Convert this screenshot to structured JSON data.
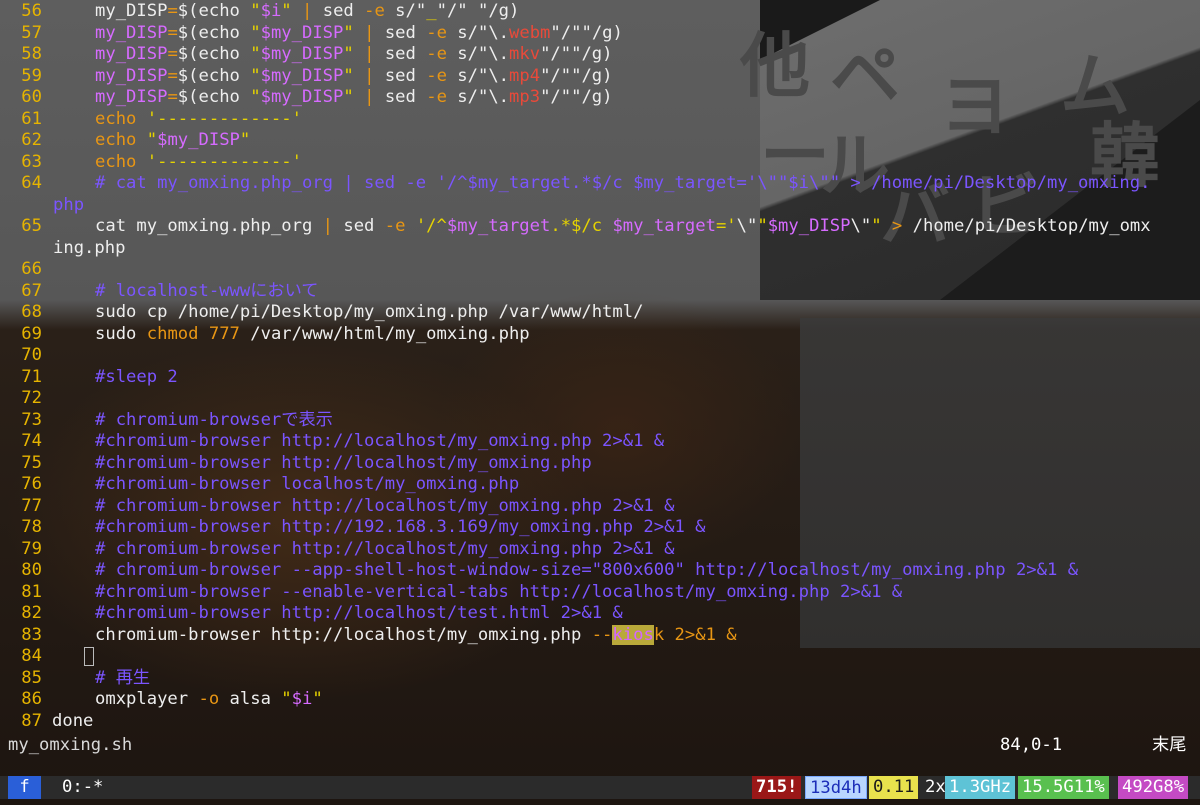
{
  "code_lines": [
    {
      "num": "56",
      "tokens": [
        [
          "def",
          "my_DISP"
        ],
        [
          "op",
          "="
        ],
        [
          "def",
          "$(echo "
        ],
        [
          "str",
          "\""
        ],
        [
          "var",
          "$i"
        ],
        [
          "str",
          "\""
        ],
        [
          "def",
          " "
        ],
        [
          "op",
          "|"
        ],
        [
          "def",
          " sed "
        ],
        [
          "op",
          "-e"
        ],
        [
          "def",
          " s/\""
        ],
        [
          "str",
          "_"
        ],
        [
          "def",
          "\"/\" \"/g)"
        ]
      ]
    },
    {
      "num": "57",
      "tokens": [
        [
          "var",
          "my_DISP"
        ],
        [
          "op",
          "="
        ],
        [
          "def",
          "$(echo "
        ],
        [
          "str",
          "\""
        ],
        [
          "var",
          "$my_DISP"
        ],
        [
          "str",
          "\""
        ],
        [
          "def",
          " "
        ],
        [
          "op",
          "|"
        ],
        [
          "def",
          " sed "
        ],
        [
          "op",
          "-e"
        ],
        [
          "def",
          " s/\"\\."
        ],
        [
          "ext",
          "webm"
        ],
        [
          "def",
          "\"/\"\"/g)"
        ]
      ]
    },
    {
      "num": "58",
      "tokens": [
        [
          "var",
          "my_DISP"
        ],
        [
          "op",
          "="
        ],
        [
          "def",
          "$(echo "
        ],
        [
          "str",
          "\""
        ],
        [
          "var",
          "$my_DISP"
        ],
        [
          "str",
          "\""
        ],
        [
          "def",
          " "
        ],
        [
          "op",
          "|"
        ],
        [
          "def",
          " sed "
        ],
        [
          "op",
          "-e"
        ],
        [
          "def",
          " s/\"\\."
        ],
        [
          "ext",
          "mkv"
        ],
        [
          "def",
          "\"/\"\"/g)"
        ]
      ]
    },
    {
      "num": "59",
      "tokens": [
        [
          "var",
          "my_DISP"
        ],
        [
          "op",
          "="
        ],
        [
          "def",
          "$(echo "
        ],
        [
          "str",
          "\""
        ],
        [
          "var",
          "$my_DISP"
        ],
        [
          "str",
          "\""
        ],
        [
          "def",
          " "
        ],
        [
          "op",
          "|"
        ],
        [
          "def",
          " sed "
        ],
        [
          "op",
          "-e"
        ],
        [
          "def",
          " s/\"\\."
        ],
        [
          "ext",
          "mp4"
        ],
        [
          "def",
          "\"/\"\"/g)"
        ]
      ]
    },
    {
      "num": "60",
      "tokens": [
        [
          "var",
          "my_DISP"
        ],
        [
          "op",
          "="
        ],
        [
          "def",
          "$(echo "
        ],
        [
          "str",
          "\""
        ],
        [
          "var",
          "$my_DISP"
        ],
        [
          "str",
          "\""
        ],
        [
          "def",
          " "
        ],
        [
          "op",
          "|"
        ],
        [
          "def",
          " sed "
        ],
        [
          "op",
          "-e"
        ],
        [
          "def",
          " s/\"\\."
        ],
        [
          "ext",
          "mp3"
        ],
        [
          "def",
          "\"/\"\"/g)"
        ]
      ]
    },
    {
      "num": "61",
      "tokens": [
        [
          "op",
          "echo "
        ],
        [
          "str",
          "'-------------'"
        ]
      ]
    },
    {
      "num": "62",
      "tokens": [
        [
          "op",
          "echo "
        ],
        [
          "str",
          "\""
        ],
        [
          "var",
          "$my_DISP"
        ],
        [
          "str",
          "\""
        ]
      ]
    },
    {
      "num": "63",
      "tokens": [
        [
          "op",
          "echo "
        ],
        [
          "str",
          "'-------------'"
        ]
      ]
    },
    {
      "num": "64",
      "tokens": [
        [
          "cmt",
          "# cat my_omxing.php_org | sed -e '/^$my_target.*$/c $my_target='\\\"\"$i\\\"\" > /home/pi/Desktop/my_omxing."
        ]
      ],
      "wrap": [
        [
          "cmt",
          "php"
        ]
      ]
    },
    {
      "num": "65",
      "tokens": [
        [
          "def",
          "cat my_omxing.php_org "
        ],
        [
          "op",
          "|"
        ],
        [
          "def",
          " sed "
        ],
        [
          "op",
          "-e"
        ],
        [
          "def",
          " "
        ],
        [
          "str",
          "'/^"
        ],
        [
          "var",
          "$my_target"
        ],
        [
          "str",
          ".*$/c "
        ],
        [
          "var",
          "$my_target"
        ],
        [
          "str",
          "='"
        ],
        [
          "def",
          "\\\""
        ],
        [
          "str",
          "\""
        ],
        [
          "var",
          "$my_DISP"
        ],
        [
          "def",
          "\\\""
        ],
        [
          "str",
          "\""
        ],
        [
          "def",
          " "
        ],
        [
          "op",
          ">"
        ],
        [
          "def",
          " /home/pi/Desktop/my_omx"
        ]
      ],
      "wrap": [
        [
          "def",
          "ing.php"
        ]
      ]
    },
    {
      "num": "66",
      "tokens": []
    },
    {
      "num": "67",
      "tokens": [
        [
          "cmt",
          "# localhost-wwwにおいて"
        ]
      ]
    },
    {
      "num": "68",
      "tokens": [
        [
          "def",
          "sudo cp /home/pi/Desktop/my_omxing.php /var/www/html/"
        ]
      ]
    },
    {
      "num": "69",
      "tokens": [
        [
          "def",
          "sudo "
        ],
        [
          "op",
          "chmod"
        ],
        [
          "def",
          " "
        ],
        [
          "op",
          "777"
        ],
        [
          "def",
          " /var/www/html/my_omxing.php"
        ]
      ]
    },
    {
      "num": "70",
      "tokens": []
    },
    {
      "num": "71",
      "tokens": [
        [
          "cmt",
          "#sleep 2"
        ]
      ]
    },
    {
      "num": "72",
      "tokens": []
    },
    {
      "num": "73",
      "tokens": [
        [
          "cmt",
          "# chromium-browserで表示"
        ]
      ]
    },
    {
      "num": "74",
      "tokens": [
        [
          "cmt",
          "#chromium-browser http://localhost/my_omxing.php 2>&1 &"
        ]
      ]
    },
    {
      "num": "75",
      "tokens": [
        [
          "cmt",
          "#chromium-browser http://localhost/my_omxing.php"
        ]
      ]
    },
    {
      "num": "76",
      "tokens": [
        [
          "cmt",
          "#chromium-browser localhost/my_omxing.php"
        ]
      ]
    },
    {
      "num": "77",
      "tokens": [
        [
          "cmt",
          "# chromium-browser http://localhost/my_omxing.php 2>&1 &"
        ]
      ]
    },
    {
      "num": "78",
      "tokens": [
        [
          "cmt",
          "#chromium-browser http://192.168.3.169/my_omxing.php 2>&1 &"
        ]
      ]
    },
    {
      "num": "79",
      "tokens": [
        [
          "cmt",
          "# chromium-browser http://localhost/my_omxing.php 2>&1 &"
        ]
      ]
    },
    {
      "num": "80",
      "tokens": [
        [
          "cmt",
          "# chromium-browser --app-shell-host-window-size=\"800x600\" http://localhost/my_omxing.php 2>&1 &"
        ]
      ]
    },
    {
      "num": "81",
      "tokens": [
        [
          "cmt",
          "#chromium-browser --enable-vertical-tabs http://localhost/my_omxing.php 2>&1 &"
        ]
      ]
    },
    {
      "num": "82",
      "tokens": [
        [
          "cmt",
          "#chromium-browser http://localhost/test.html 2>&1 &"
        ]
      ]
    },
    {
      "num": "83",
      "tokens": [
        [
          "def",
          "chromium-browser http://localhost/my_omxing.php "
        ],
        [
          "op",
          "--"
        ],
        [
          "kio",
          "kios"
        ],
        [
          "op",
          "k"
        ],
        [
          "def",
          " "
        ],
        [
          "op",
          "2>&1"
        ],
        [
          "def",
          " "
        ],
        [
          "op",
          "&"
        ]
      ]
    },
    {
      "num": "84",
      "tokens": [],
      "cursor": true
    },
    {
      "num": "85",
      "tokens": [
        [
          "cmt",
          "# 再生"
        ]
      ]
    },
    {
      "num": "86",
      "tokens": [
        [
          "def",
          "omxplayer "
        ],
        [
          "op",
          "-o"
        ],
        [
          "def",
          " alsa "
        ],
        [
          "str",
          "\""
        ],
        [
          "var",
          "$i"
        ],
        [
          "str",
          "\""
        ]
      ]
    },
    {
      "num": "87",
      "tokens": [
        [
          "def",
          "done"
        ]
      ],
      "noindent": true
    }
  ],
  "status_line": {
    "file_name": "my_omxing.sh",
    "cursor_position": "84,0-1",
    "cursor_end": "末尾"
  },
  "tmux_bar": {
    "session": "f",
    "window": "0:-*",
    "errors": "715!",
    "uptime": "13d4h",
    "load": "0.11",
    "cpu_prefix": "2x",
    "cpu_freq": "1.3GHz",
    "memory": "15.5G11%",
    "disk": "492G8%"
  },
  "poster_glyphs": [
    "他",
    "ペ",
    "ム",
    "ー",
    "ヨ",
    "ル",
    "バ",
    "ビ",
    "韓"
  ],
  "colors": {
    "line_number": "#e6b400",
    "comment": "#7b55ff",
    "variable": "#d66bff",
    "string": "#e6d300",
    "operator": "#e89614",
    "extension": "#e84a3a",
    "session_badge": "#2a5fd8",
    "error_badge": "#9a1717"
  }
}
